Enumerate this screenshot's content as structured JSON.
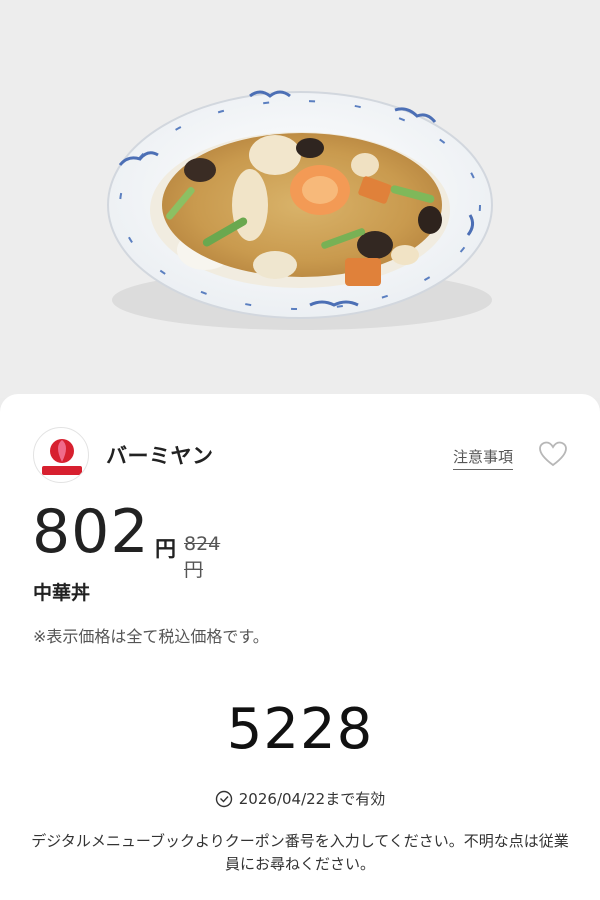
{
  "hero": {
    "image": "chuka-don-bowl-photo"
  },
  "shop": {
    "name": "バーミヤン",
    "logo": "bamiyan-logo"
  },
  "links": {
    "notes": "注意事項"
  },
  "icons": {
    "favorite": "heart-outline-icon",
    "validity": "clock-icon"
  },
  "price": {
    "value": "802",
    "unit": "円",
    "original": "824円"
  },
  "item": {
    "name": "中華丼"
  },
  "tax_note": "※表示価格は全て税込価格です。",
  "coupon": {
    "code": "5228",
    "validity": "2026/04/22まで有効",
    "instructions": "デジタルメニューブックよりクーポン番号を入力してください。不明な点は従業員にお尋ねください。"
  },
  "colors": {
    "logo_red": "#d7202f",
    "logo_pink": "#f06a8a",
    "background": "#ececec",
    "card": "#ffffff"
  }
}
